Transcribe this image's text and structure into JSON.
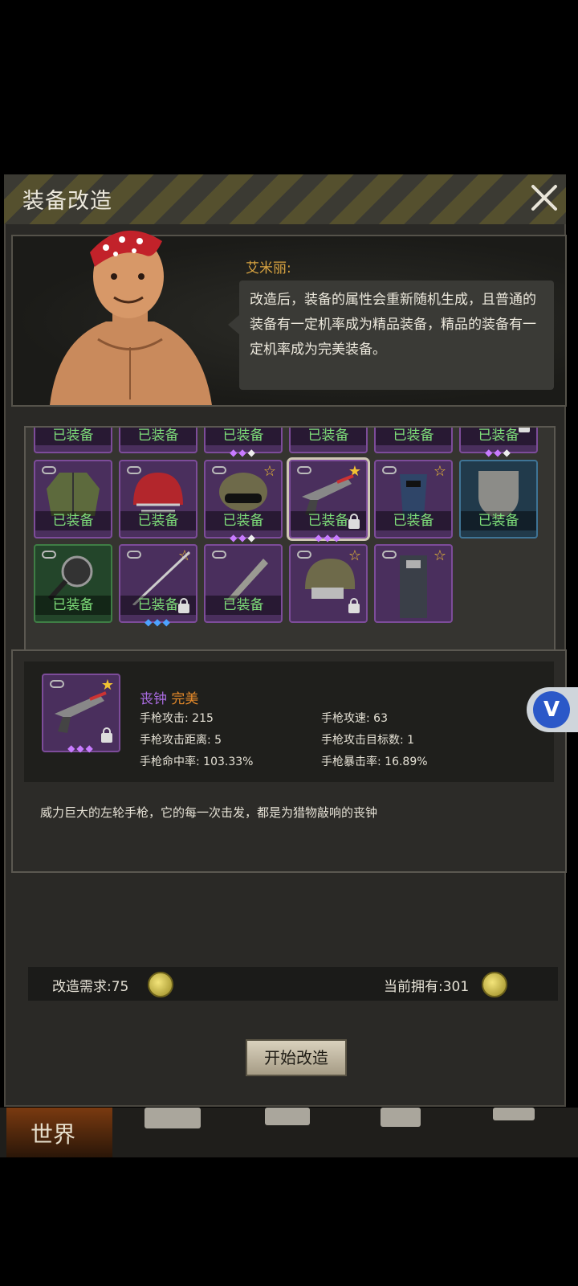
{
  "dialog": {
    "title": "装备改造"
  },
  "npc": {
    "name": "艾米丽:",
    "speech": "改造后，装备的属性会重新随机生成，且普通的装备有一定机率成为精品装备，精品的装备有一定机率成为完美装备。"
  },
  "grid": {
    "row0": [
      "已装备",
      "已装备",
      "已装备",
      "已装备",
      "已装备",
      "已装备"
    ],
    "row1": [
      {
        "label": "已装备",
        "icon": "jacket-icon",
        "rarity": "purple"
      },
      {
        "label": "已装备",
        "icon": "red-helmet-icon",
        "rarity": "purple"
      },
      {
        "label": "已装备",
        "icon": "tactical-helmet-icon",
        "rarity": "purple"
      },
      {
        "label": "已装备",
        "icon": "revolver-icon",
        "rarity": "purple",
        "selected": true
      },
      {
        "label": "已装备",
        "icon": "welding-mask-icon",
        "rarity": "purple"
      },
      {
        "label": "已装备",
        "icon": "shield-icon",
        "rarity": "blue"
      }
    ],
    "row2": [
      {
        "label": "已装备",
        "icon": "frying-pan-icon",
        "rarity": "green"
      },
      {
        "label": "已装备",
        "icon": "katana-icon",
        "rarity": "purple"
      },
      {
        "label": "已装备",
        "icon": "machete-icon",
        "rarity": "purple"
      },
      {
        "label": "",
        "icon": "camo-helmet-icon",
        "rarity": "purple"
      },
      {
        "label": "",
        "icon": "armor-vest-icon",
        "rarity": "purple"
      }
    ]
  },
  "item": {
    "name": "丧钟",
    "quality": "完美",
    "stats": [
      "手枪攻击: 215",
      "手枪攻速: 63",
      "手枪攻击距离: 5",
      "手枪攻击目标数: 1",
      "手枪命中率: 103.33%",
      "手枪暴击率: 16.89%"
    ],
    "description": "威力巨大的左轮手枪，它的每一次击发，都是为猎物敲响的丧钟"
  },
  "cost": {
    "required": "改造需求:75",
    "owned": "当前拥有:301"
  },
  "start_button": "开始改造",
  "nav": {
    "world": "世界"
  },
  "colors": {
    "purple_name": "#a96be0",
    "perfect_orange": "#e58a2a",
    "equipped_green": "#7fe07a",
    "npc_name": "#d9a441"
  }
}
